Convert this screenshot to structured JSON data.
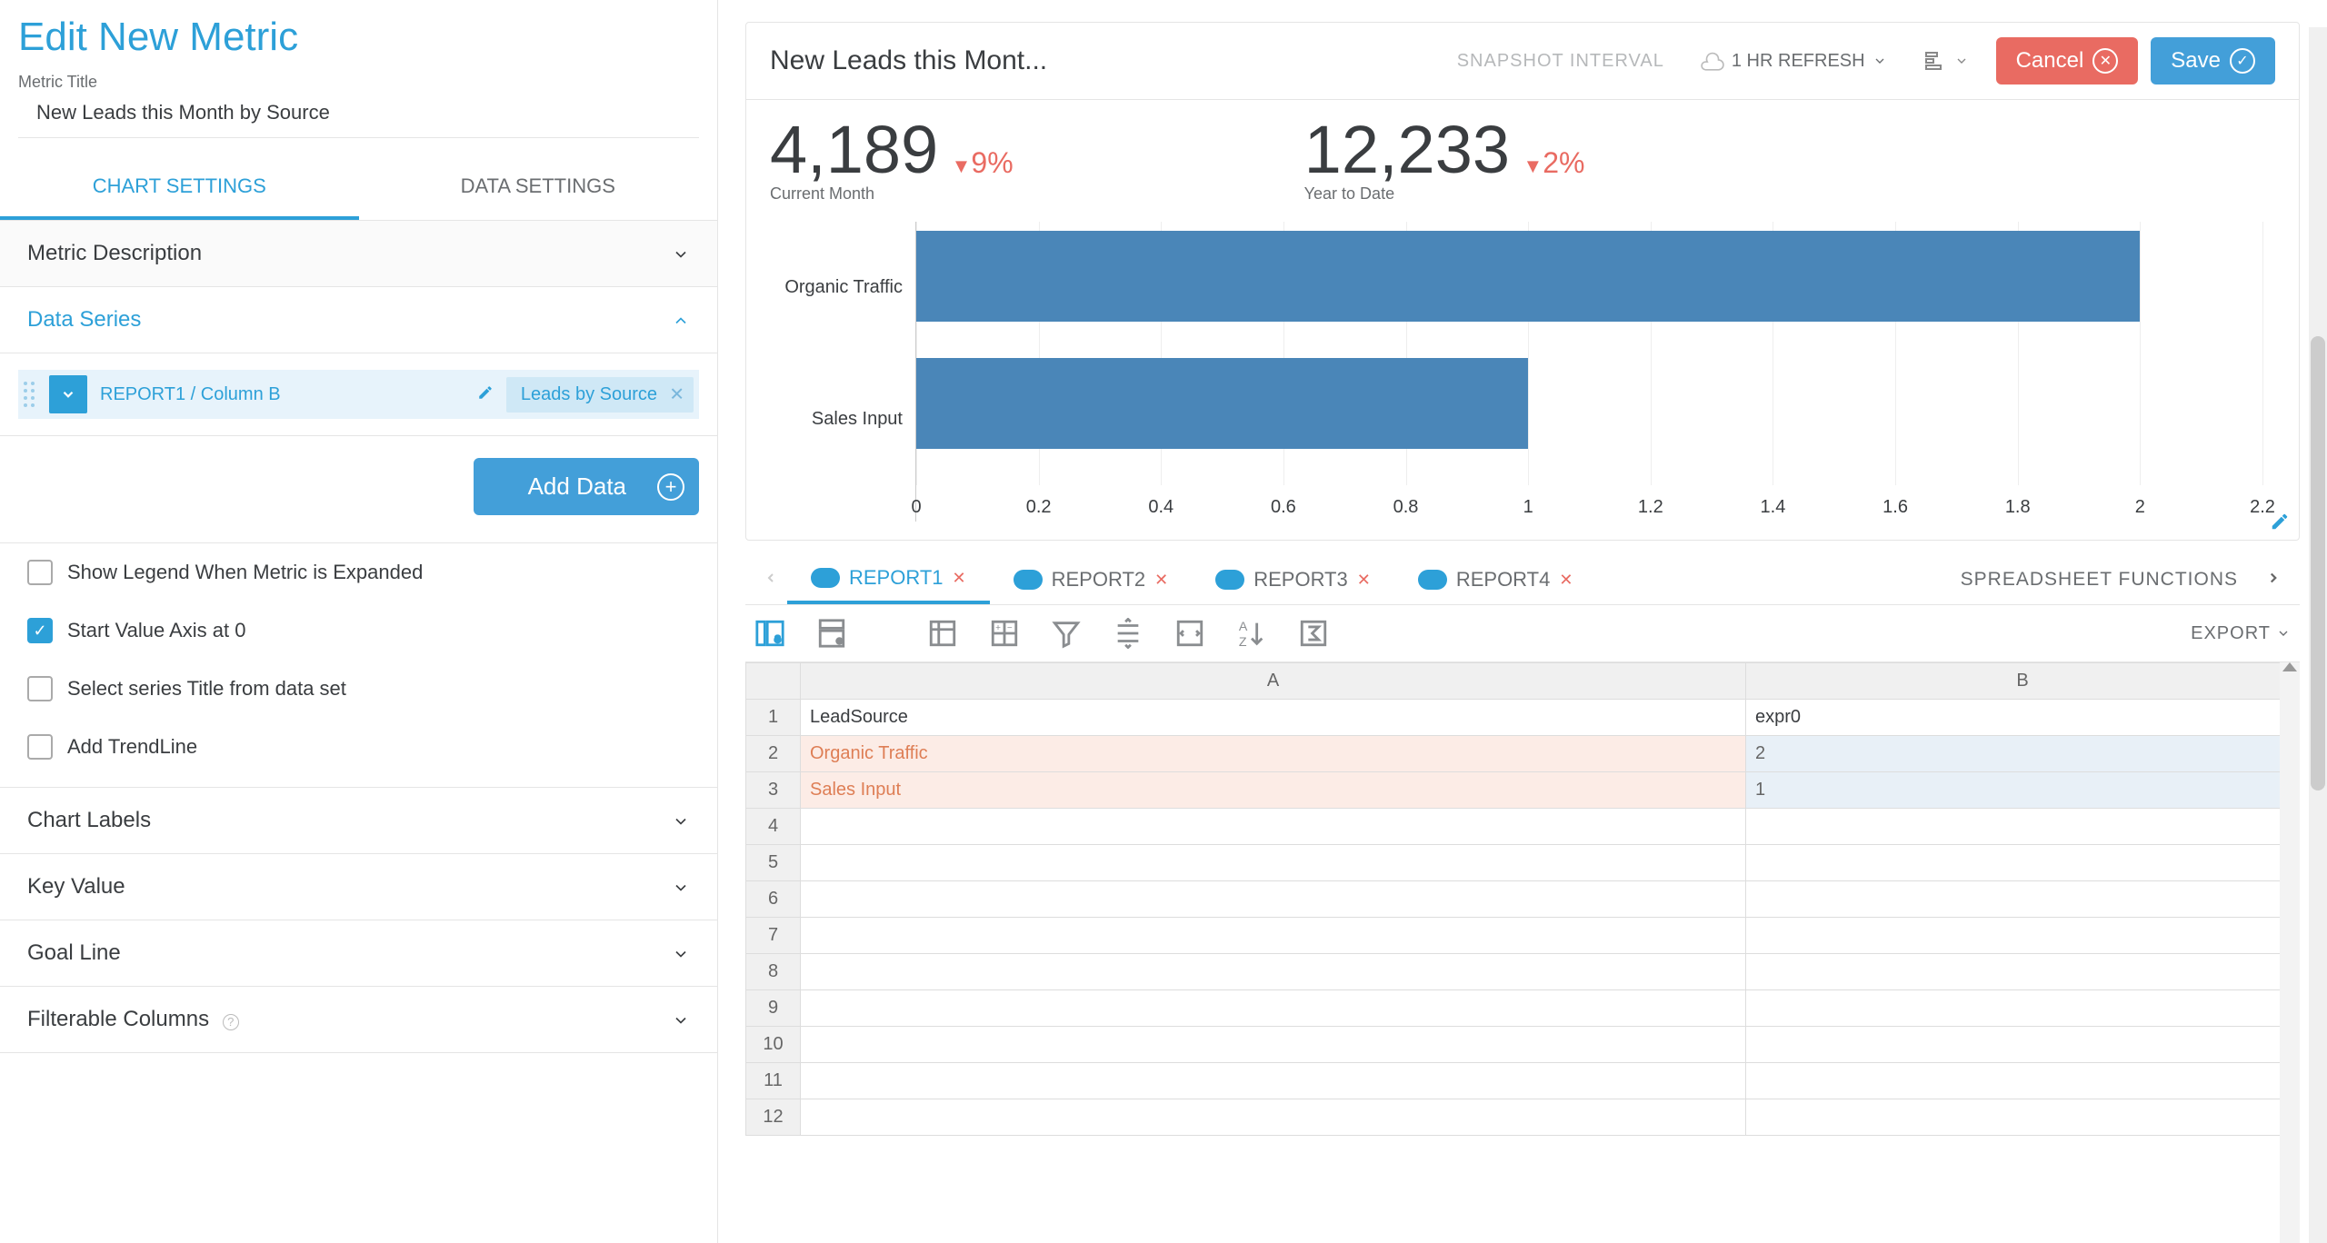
{
  "page_title": "Edit New Metric",
  "metric_title_label": "Metric Title",
  "metric_title_value": "New Leads this Month by Source",
  "left_tabs": {
    "chart": "CHART SETTINGS",
    "data": "DATA SETTINGS"
  },
  "accordion": {
    "metric_description": "Metric Description",
    "data_series": "Data Series",
    "chart_labels": "Chart Labels",
    "key_value": "Key Value",
    "goal_line": "Goal Line",
    "filterable_columns": "Filterable Columns"
  },
  "data_series": {
    "source_label": "REPORT1 / Column B",
    "pill_label": "Leads by Source",
    "add_data": "Add Data"
  },
  "checks": {
    "show_legend": "Show Legend When Metric is Expanded",
    "start_zero": "Start Value Axis at 0",
    "series_title": "Select series Title from data set",
    "add_trendline": "Add TrendLine"
  },
  "top": {
    "title": "New Leads this Mont...",
    "snapshot": "SNAPSHOT INTERVAL",
    "refresh": "1 HR REFRESH",
    "cancel": "Cancel",
    "save": "Save"
  },
  "kpi": {
    "current_value": "4,189",
    "current_delta": "9%",
    "current_label": "Current Month",
    "ytd_value": "12,233",
    "ytd_delta": "2%",
    "ytd_label": "Year to Date"
  },
  "chart_data": {
    "type": "bar",
    "orientation": "horizontal",
    "categories": [
      "Organic Traffic",
      "Sales Input"
    ],
    "values": [
      2,
      1
    ],
    "xlabel": "",
    "ylabel": "",
    "xlim": [
      0,
      2.2
    ],
    "x_ticks": [
      0,
      0.2,
      0.4,
      0.6,
      0.8,
      1.0,
      1.2,
      1.4,
      1.6,
      1.8,
      2.0,
      2.2
    ]
  },
  "report_tabs": [
    "REPORT1",
    "REPORT2",
    "REPORT3",
    "REPORT4"
  ],
  "spreadsheet_fn": "SPREADSHEET FUNCTIONS",
  "export_label": "EXPORT",
  "sheet": {
    "columns": [
      "A",
      "B"
    ],
    "rows": [
      {
        "n": 1,
        "a": "LeadSource",
        "b": "expr0",
        "hl": false
      },
      {
        "n": 2,
        "a": "Organic Traffic",
        "b": "2",
        "hl": true
      },
      {
        "n": 3,
        "a": "Sales Input",
        "b": "1",
        "hl": true
      },
      {
        "n": 4,
        "a": "",
        "b": "",
        "hl": false
      },
      {
        "n": 5,
        "a": "",
        "b": "",
        "hl": false
      },
      {
        "n": 6,
        "a": "",
        "b": "",
        "hl": false
      },
      {
        "n": 7,
        "a": "",
        "b": "",
        "hl": false
      },
      {
        "n": 8,
        "a": "",
        "b": "",
        "hl": false
      },
      {
        "n": 9,
        "a": "",
        "b": "",
        "hl": false
      },
      {
        "n": 10,
        "a": "",
        "b": "",
        "hl": false
      },
      {
        "n": 11,
        "a": "",
        "b": "",
        "hl": false
      },
      {
        "n": 12,
        "a": "",
        "b": "",
        "hl": false
      }
    ]
  }
}
